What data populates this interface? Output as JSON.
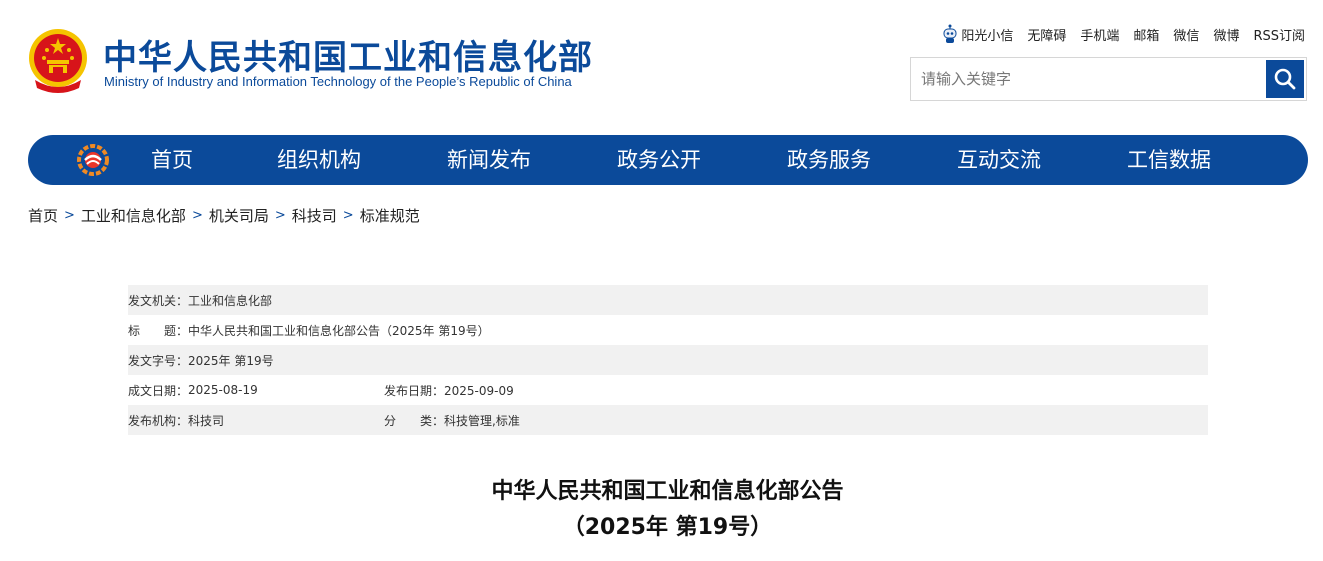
{
  "header": {
    "title_cn": "中华人民共和国工业和信息化部",
    "title_en": "Ministry of Industry and Information Technology of the People’s Republic of China"
  },
  "toplinks": [
    "阳光小信",
    "无障碍",
    "手机端",
    "邮箱",
    "微信",
    "微博",
    "RSS订阅"
  ],
  "search": {
    "placeholder": "请输入关键字"
  },
  "nav": [
    "首页",
    "组织机构",
    "新闻发布",
    "政务公开",
    "政务服务",
    "互动交流",
    "工信数据"
  ],
  "breadcrumb": [
    "首页",
    "工业和信息化部",
    "机关司局",
    "科技司",
    "标准规范"
  ],
  "meta": {
    "issuer_label": "发文机关：",
    "issuer": "工业和信息化部",
    "title_label": "标　　题：",
    "title": "中华人民共和国工业和信息化部公告（2025年 第19号）",
    "doc_no_label": "发文字号：",
    "doc_no": "2025年 第19号",
    "written_label": "成文日期：",
    "written": "2025-08-19",
    "published_label": "发布日期：",
    "published": "2025-09-09",
    "org_label": "发布机构：",
    "org": "科技司",
    "category_label": "分　　类：",
    "category": "科技管理,标准"
  },
  "article": {
    "title_line1": "中华人民共和国工业和信息化部公告",
    "title_line2": "（2025年 第19号）"
  },
  "colors": {
    "brand": "#0b4a9a",
    "row_shade": "#f1f1f1",
    "emblem_red": "#d7141a",
    "emblem_gold": "#f5c400"
  }
}
